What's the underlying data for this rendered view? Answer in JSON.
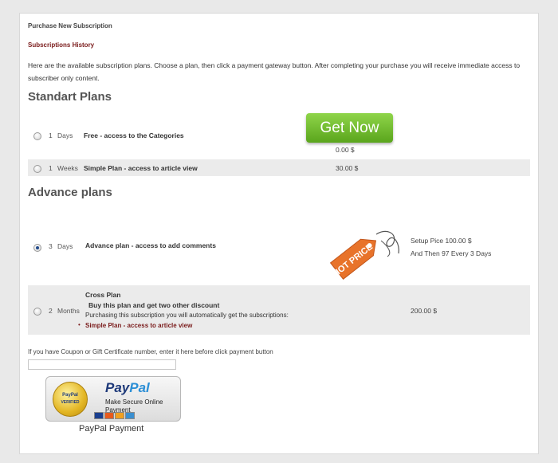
{
  "header": {
    "title": "Purchase New Subscription",
    "history_link": "Subscriptions History",
    "intro": "Here are the available subscription plans. Choose a plan, then click a payment gateway button. After completing your purchase you will receive immediate access to subscriber only content."
  },
  "standard": {
    "title": "Standart Plans",
    "rows": [
      {
        "num": "1",
        "unit": "Days",
        "plan": "Free - access to the Categories",
        "price": "0.00 $"
      },
      {
        "num": "1",
        "unit": "Weeks",
        "plan": "Simple Plan - access to article view",
        "price": "30.00 $"
      }
    ],
    "get_now": "Get Now"
  },
  "advance": {
    "title": "Advance plans",
    "rows": [
      {
        "num": "3",
        "unit": "Days",
        "plan": "Advance plan - access to add comments",
        "price_line1": "Setup Pice 100.00 $",
        "price_line2": "And Then 97 Every 3 Days",
        "tag": "HOT PRICE"
      },
      {
        "num": "2",
        "unit": "Months",
        "plan": "Cross Plan",
        "sub1": "Buy this plan and get two other discount",
        "sub2": "Purchasing this subscription you will automatically get the subscriptions:",
        "bullet": "Simple Plan - access to article view",
        "price": "200.00 $"
      }
    ]
  },
  "coupon": {
    "label": "If you have Coupon or Gift Certificate number, enter it here before click payment button",
    "value": ""
  },
  "paypal": {
    "seal_top": "PayPal",
    "seal_bottom": "VERIFIED",
    "logo_pay": "Pay",
    "logo_pal": "Pal",
    "tagline": "Make Secure Online Payment",
    "caption": "PayPal Payment"
  },
  "colors": {
    "accent_green": "#6cbf2c",
    "tag_orange": "#e8732a",
    "link_red": "#7a1b1b",
    "paypal_blue": "#1f3a7a"
  }
}
